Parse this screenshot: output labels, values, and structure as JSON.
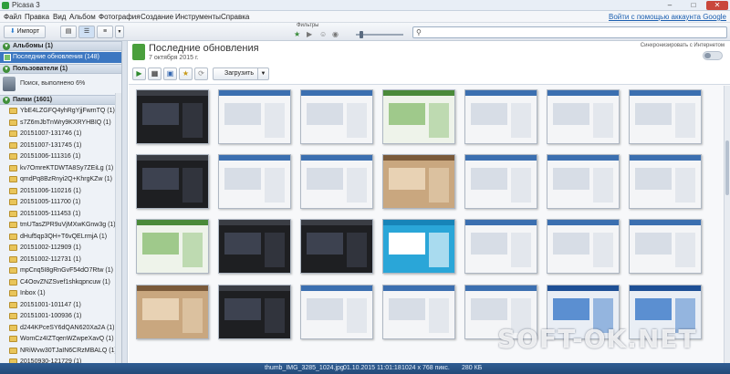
{
  "window": {
    "title": "Picasa 3"
  },
  "menu": {
    "items": [
      "Файл",
      "Правка",
      "Вид",
      "Альбом",
      "Фотография",
      "Создание",
      "Инструменты",
      "Справка"
    ],
    "signin": "Войти с помощью аккаунта Google"
  },
  "toolbar": {
    "import_label": "Импорт",
    "filters_label": "Фильтры",
    "search_placeholder": ""
  },
  "sidebar": {
    "albums_header": "Альбомы (1)",
    "album_item": "Последние обновления (148)",
    "people_header": "Пользователи (1)",
    "people_status": "Поиск, выполнено  6%",
    "folders_header": "Папки (1601)",
    "folders": [
      "YbE4LZGFQ4yhRgYjjFwmTQ (1)",
      "s7Z6mJbTnWry9KXRYHBIQ (1)",
      "20151007-131746 (1)",
      "20151007-131745 (1)",
      "20151006-111316 (1)",
      "kv7OmreKTDWTA8Sy7ZEiLg (1)",
      "qmdPq8BzRnyi2Q+KhrgKZw (1)",
      "20151006-110216 (1)",
      "20151005-111700 (1)",
      "20151005-111453 (1)",
      "tmUTasZPR9uVjMXwKGnw3g (1)",
      "dHuf5qp3QH+T6vQELrmjA (1)",
      "20151002-112909 (1)",
      "20151002-112731 (1)",
      "mpCnq5I8gRnGvF54dO7Rtw (1)",
      "C4OovZNZSvef1shkqpncuw (1)",
      "Inbox (1)",
      "20151001-101147 (1)",
      "20151001-100936 (1)",
      "d244KPceSY6dQAN620Xa2A (1)",
      "WomCz4IZTqenWZwpeXavQ (1)",
      "NRiWvw30TJaIN6CRzMBALQ (1)",
      "20150930-121729 (1)"
    ]
  },
  "album": {
    "title": "Последние обновления",
    "date": "7 октября 2015 г.",
    "sync_label": "Синхронизировать с Интернетом",
    "upload_label": "Загрузить"
  },
  "thumbnails": [
    {
      "theme": "dark"
    },
    {
      "theme": "light"
    },
    {
      "theme": "light"
    },
    {
      "theme": "green"
    },
    {
      "theme": "light"
    },
    {
      "theme": "light"
    },
    {
      "theme": "light"
    },
    {
      "theme": "dark"
    },
    {
      "theme": "dark"
    },
    {
      "theme": "light"
    },
    {
      "theme": "light"
    },
    {
      "theme": "photo"
    },
    {
      "theme": "light"
    },
    {
      "theme": "light"
    },
    {
      "theme": "light"
    },
    {
      "theme": "light"
    },
    {
      "theme": "green"
    },
    {
      "theme": "dark"
    },
    {
      "theme": "dark"
    },
    {
      "theme": "cyan"
    },
    {
      "theme": "light"
    },
    {
      "theme": "light"
    },
    {
      "theme": "light"
    },
    {
      "theme": "light"
    },
    {
      "theme": "photo"
    },
    {
      "theme": "dark"
    },
    {
      "theme": "light"
    },
    {
      "theme": "light"
    },
    {
      "theme": "light"
    },
    {
      "theme": "blue"
    },
    {
      "theme": "blue"
    },
    {
      "theme": "blue"
    }
  ],
  "status": {
    "file": "thumb_IMG_3285_1024.jpg",
    "date": "01.10.2015 11:01:18",
    "dims": "1024 x 768 пикс.",
    "size": "280 КБ"
  },
  "watermark": "SOFT-OK.NET",
  "colors": {
    "selection": "#3c77c1",
    "statusbar": "#2f5d93",
    "accent_green": "#4a9f3c"
  }
}
